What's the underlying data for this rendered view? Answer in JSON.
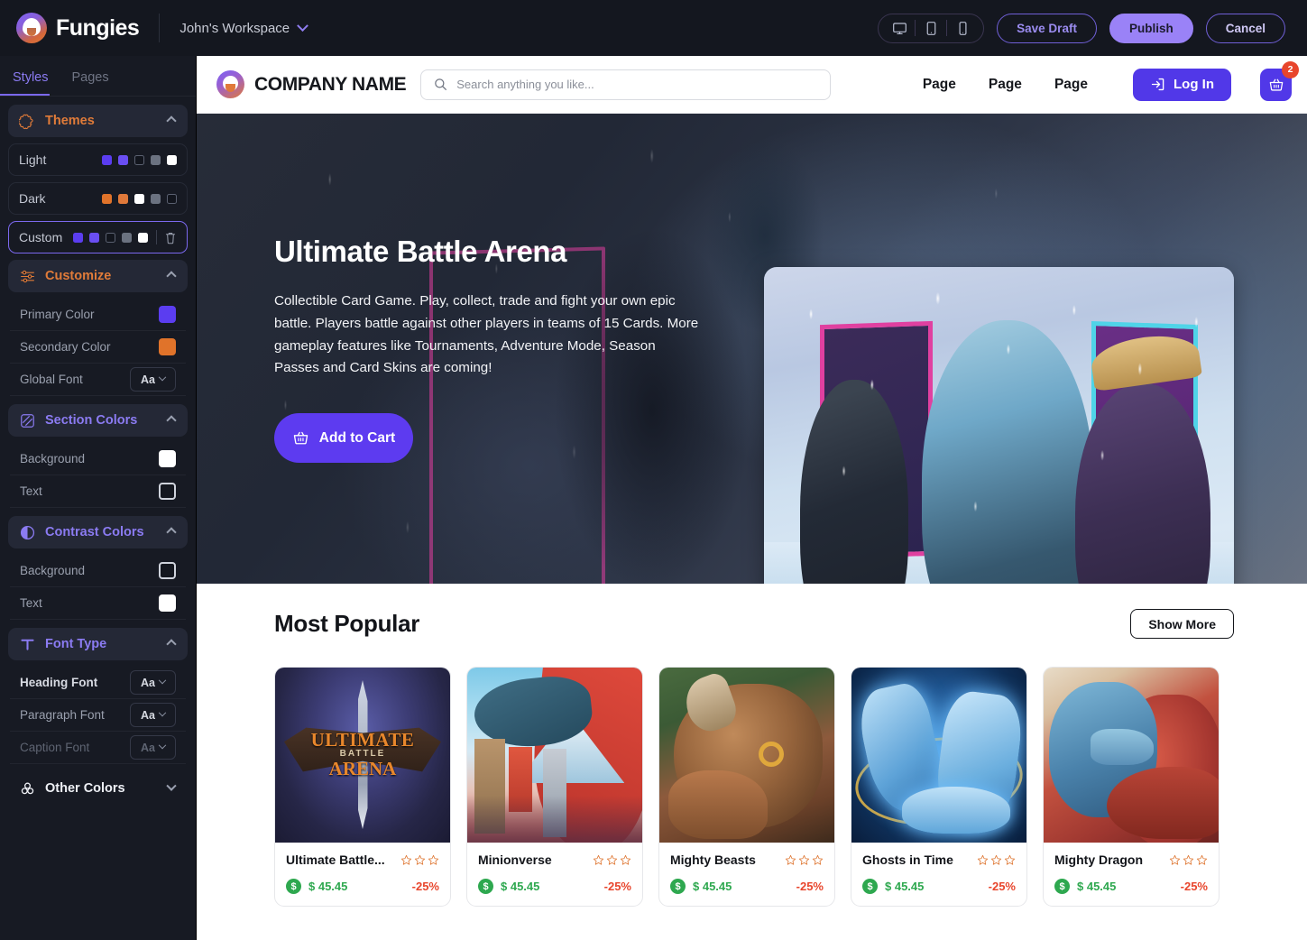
{
  "topbar": {
    "brand_name": "Fungies",
    "workspace_name": "John's Workspace",
    "devices": [
      "desktop-icon",
      "tablet-icon",
      "mobile-icon"
    ],
    "save_draft_label": "Save Draft",
    "publish_label": "Publish",
    "cancel_label": "Cancel"
  },
  "sidebar": {
    "tabs": [
      {
        "label": "Styles",
        "active": true
      },
      {
        "label": "Pages",
        "active": false
      }
    ],
    "themes_section": {
      "title": "Themes",
      "icon": "puzzle-icon",
      "expanded": true,
      "themes": [
        {
          "name": "Light",
          "selected": false,
          "swatches": [
            "#5b3df0",
            "#6a4ef2",
            "#12151d",
            "#6b7280",
            "#ffffff"
          ]
        },
        {
          "name": "Dark",
          "selected": false,
          "swatches": [
            "#e0732a",
            "#e0793a",
            "#ffffff",
            "#6b7280",
            "#12151d"
          ]
        },
        {
          "name": "Custom",
          "selected": true,
          "swatches": [
            "#5b3df0",
            "#6a4ef2",
            "#12151d",
            "#6b7280",
            "#ffffff"
          ],
          "delete_icon": "trash-icon"
        }
      ]
    },
    "customize_section": {
      "title": "Customize",
      "icon": "sliders-icon",
      "expanded": true,
      "rows": [
        {
          "label": "Primary Color",
          "type": "color",
          "value": "#5b3df0"
        },
        {
          "label": "Secondary Color",
          "type": "color",
          "value": "#e0732a"
        },
        {
          "label": "Global Font",
          "type": "font",
          "value": "Aa"
        }
      ]
    },
    "section_colors": {
      "title": "Section Colors",
      "icon": "diagonal-square-icon",
      "expanded": true,
      "rows": [
        {
          "label": "Background",
          "type": "color",
          "value": "#ffffff"
        },
        {
          "label": "Text",
          "type": "color",
          "value": "#14171f"
        }
      ]
    },
    "contrast_colors": {
      "title": "Contrast Colors",
      "icon": "half-circle-icon",
      "expanded": true,
      "rows": [
        {
          "label": "Background",
          "type": "color",
          "value": "#14171f"
        },
        {
          "label": "Text",
          "type": "color",
          "value": "#ffffff"
        }
      ]
    },
    "font_type": {
      "title": "Font Type",
      "icon": "text-t-icon",
      "expanded": true,
      "rows": [
        {
          "label": "Heading Font",
          "value": "Aa",
          "emphasis": "bold"
        },
        {
          "label": "Paragraph Font",
          "value": "Aa",
          "emphasis": "normal"
        },
        {
          "label": "Caption Font",
          "value": "Aa",
          "emphasis": "dim"
        }
      ]
    },
    "other_colors": {
      "title": "Other Colors",
      "icon": "circles-icon",
      "expanded": false
    }
  },
  "preview": {
    "site_header": {
      "company_name": "COMPANY NAME",
      "logo_icon": "fungies-circle-icon",
      "search_placeholder": "Search anything you like...",
      "search_value": "",
      "search_icon": "search-icon",
      "nav_links": [
        "Page",
        "Page",
        "Page"
      ],
      "login_label": "Log In",
      "login_icon": "login-arrow-icon",
      "cart_icon": "basket-icon",
      "cart_count": "2"
    },
    "hero": {
      "title": "Ultimate Battle Arena",
      "description": "Collectible Card Game. Play, collect, trade and fight your own epic battle. Players battle against other players in teams of 15 Cards. More gameplay features like Tournaments, Adventure Mode, Season Passes and Card Skins are coming!",
      "cta_label": "Add to Cart",
      "cta_icon": "basket-icon",
      "cta_color": "#5d3bf0"
    },
    "popular": {
      "title": "Most Popular",
      "show_more_label": "Show More",
      "cards": [
        {
          "name": "Ultimate Battle...",
          "price": "$ 45.45",
          "discount": "-25%",
          "stars": 3,
          "art": "art-uba",
          "currency_icon": "dollar-coin-icon"
        },
        {
          "name": "Minionverse",
          "price": "$ 45.45",
          "discount": "-25%",
          "stars": 3,
          "art": "art-mv",
          "currency_icon": "dollar-coin-icon"
        },
        {
          "name": "Mighty Beasts",
          "price": "$ 45.45",
          "discount": "-25%",
          "stars": 3,
          "art": "art-mb",
          "currency_icon": "dollar-coin-icon"
        },
        {
          "name": "Ghosts in Time",
          "price": "$ 45.45",
          "discount": "-25%",
          "stars": 3,
          "art": "art-gt",
          "currency_icon": "dollar-coin-icon"
        },
        {
          "name": "Mighty Dragon",
          "price": "$ 45.45",
          "discount": "-25%",
          "stars": 3,
          "art": "art-md",
          "currency_icon": "dollar-coin-icon"
        }
      ]
    }
  },
  "card_art_text": {
    "uba_line1": "ULTIMATE",
    "uba_line2": "BATTLE",
    "uba_line3": "ARENA"
  },
  "colors": {
    "accent_purple": "#5b3df0",
    "accent_orange": "#e0732a",
    "publish_purple": "#9a82f7",
    "price_green": "#2ea84f",
    "discount_red": "#e8452c",
    "topbar_bg": "#14171f",
    "sidebar_bg": "#171a23"
  }
}
